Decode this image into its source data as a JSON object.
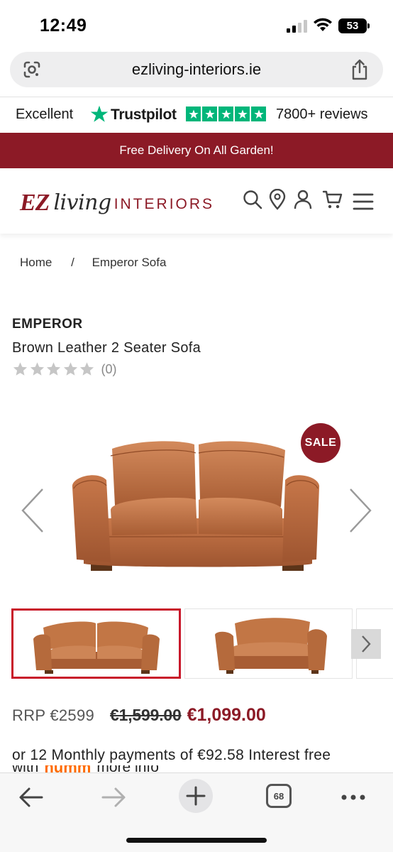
{
  "status_bar": {
    "time": "12:49",
    "battery": "53"
  },
  "browser": {
    "url": "ezliving-interiors.ie",
    "tab_count": "68"
  },
  "trustpilot": {
    "rating_word": "Excellent",
    "brand": "Trustpilot",
    "reviews": "7800+ reviews",
    "color": "#00b67a"
  },
  "promo_banner": {
    "text": "Free Delivery On All Garden!",
    "color": "#8c1a26"
  },
  "header": {
    "logo": {
      "ez": "EZ",
      "living": "living",
      "interiors": "INTERIORS"
    },
    "icons": [
      "search-icon",
      "location-icon",
      "account-icon",
      "cart-icon",
      "menu-icon"
    ]
  },
  "breadcrumb": {
    "home": "Home",
    "separator": "/",
    "current": "Emperor Sofa"
  },
  "product": {
    "brand": "EMPEROR",
    "name": "Brown Leather 2 Seater Sofa",
    "rating_stars": 0,
    "rating_count": "(0)",
    "sale_badge": "SALE",
    "rrp": "RRP €2599",
    "old_price": "€1,599.00",
    "new_price": "€1,099.00",
    "finance_text": "or 12 Monthly payments of €92.58 Interest free",
    "finance_line2_prefix": "with",
    "finance_provider": "humm",
    "finance_line2_suffix": "more info"
  },
  "gallery": {
    "thumbnail_count": 3,
    "active_index": 0
  },
  "colors": {
    "accent": "#8c1a26",
    "active_thumb_border": "#c8182a",
    "sofa": "#b8693c"
  }
}
